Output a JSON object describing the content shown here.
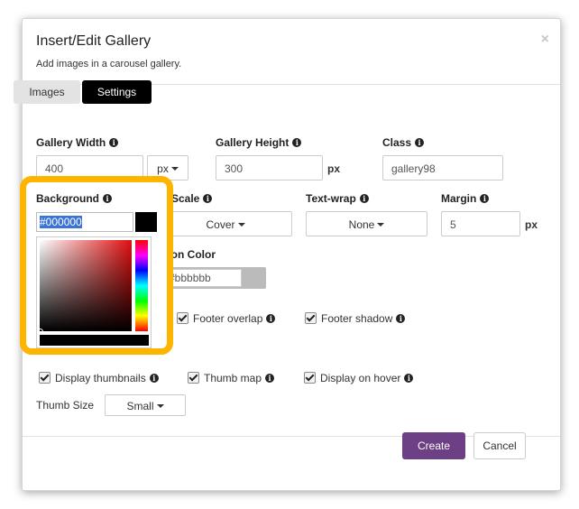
{
  "dialog": {
    "title": "Insert/Edit Gallery",
    "subtitle": "Add images in a carousel gallery.",
    "close_icon": "×"
  },
  "tabs": [
    {
      "label": "Images",
      "active": false
    },
    {
      "label": "Settings",
      "active": true
    }
  ],
  "fields": {
    "gallery_width": {
      "label": "Gallery Width",
      "value": "400",
      "unit": "px"
    },
    "gallery_height": {
      "label": "Gallery Height",
      "value": "300",
      "unit": "px"
    },
    "class": {
      "label": "Class",
      "value": "gallery98"
    },
    "background": {
      "label": "Background",
      "value": "#000000"
    },
    "scale": {
      "label": "Scale",
      "value": "Cover"
    },
    "text_wrap": {
      "label": "Text-wrap",
      "value": "None"
    },
    "margin": {
      "label": "Margin",
      "value": "5",
      "unit": "px"
    },
    "caption_color": {
      "label": "ption Color",
      "value": "#bbbbbb"
    }
  },
  "checkboxes": {
    "footer_overlap": {
      "label": "Footer overlap",
      "checked": true
    },
    "footer_shadow": {
      "label": "Footer shadow",
      "checked": true
    },
    "display_thumbnails": {
      "label": "Display thumbnails",
      "checked": true
    },
    "thumb_map": {
      "label": "Thumb map",
      "checked": true
    },
    "display_on_hover": {
      "label": "Display on hover",
      "checked": true
    }
  },
  "thumb_size": {
    "label": "Thumb Size",
    "value": "Small"
  },
  "footer": {
    "create_label": "Create",
    "cancel_label": "Cancel"
  },
  "colors": {
    "accent": "#6d3f84",
    "highlight": "#ffb400",
    "tab_active": "#000000"
  },
  "icons": {
    "info": "i"
  }
}
